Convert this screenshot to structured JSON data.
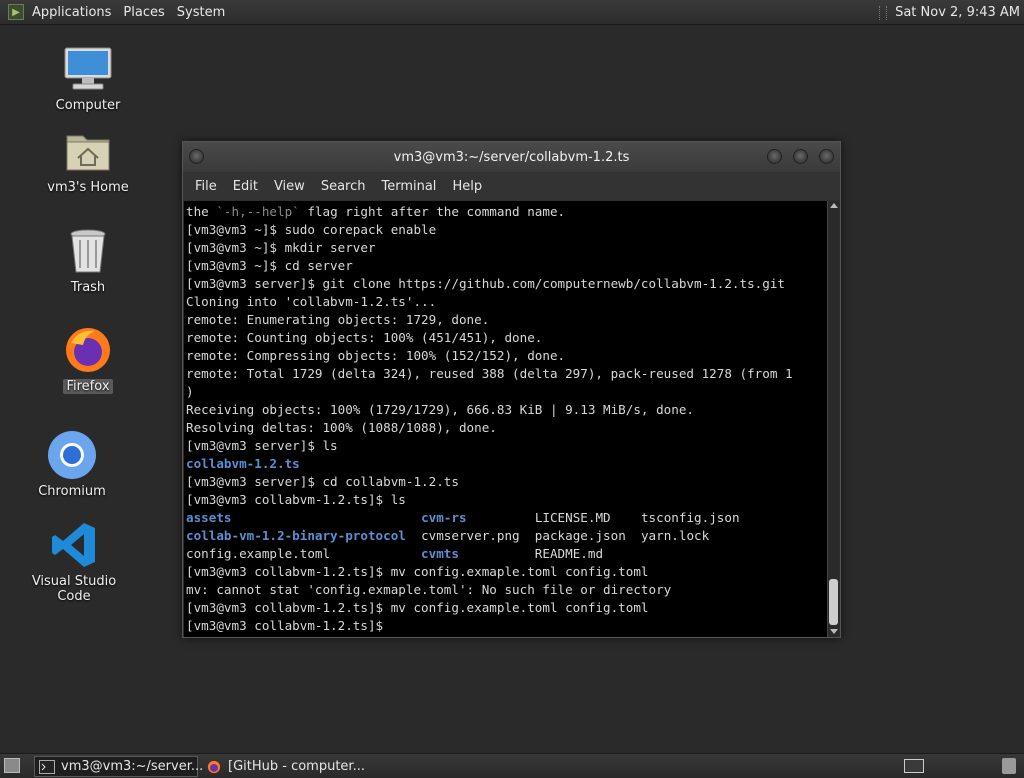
{
  "top_panel": {
    "menus": [
      "Applications",
      "Places",
      "System"
    ],
    "clock": "Sat Nov 2,  9:43 AM"
  },
  "desktop": {
    "icons": [
      {
        "label": "Computer"
      },
      {
        "label": "vm3's Home"
      },
      {
        "label": "Trash"
      },
      {
        "label": "Firefox"
      },
      {
        "label": "Chromium"
      },
      {
        "label": "Visual Studio Code"
      }
    ]
  },
  "terminal": {
    "title": "vm3@vm3:~/server/collabvm-1.2.ts",
    "menu": [
      "File",
      "Edit",
      "View",
      "Search",
      "Terminal",
      "Help"
    ],
    "lines": [
      "the `-h,--help` flag right after the command name.",
      "[vm3@vm3 ~]$ sudo corepack enable",
      "[vm3@vm3 ~]$ mkdir server",
      "[vm3@vm3 ~]$ cd server",
      "[vm3@vm3 server]$ git clone https://github.com/computernewb/collabvm-1.2.ts.git",
      "Cloning into 'collabvm-1.2.ts'...",
      "remote: Enumerating objects: 1729, done.",
      "remote: Counting objects: 100% (451/451), done.",
      "remote: Compressing objects: 100% (152/152), done.",
      "remote: Total 1729 (delta 324), reused 388 (delta 297), pack-reused 1278 (from 1",
      ")",
      "Receiving objects: 100% (1729/1729), 666.83 KiB | 9.13 MiB/s, done.",
      "Resolving deltas: 100% (1088/1088), done.",
      "[vm3@vm3 server]$ ls",
      "collabvm-1.2.ts",
      "[vm3@vm3 server]$ cd collabvm-1.2.ts",
      "[vm3@vm3 collabvm-1.2.ts]$ ls",
      "ls_row_1",
      "ls_row_2",
      "ls_row_3",
      "[vm3@vm3 collabvm-1.2.ts]$ mv config.exmaple.toml config.toml",
      "mv: cannot stat 'config.exmaple.toml': No such file or directory",
      "[vm3@vm3 collabvm-1.2.ts]$ mv config.example.toml config.toml",
      "[vm3@vm3 collabvm-1.2.ts]$ "
    ],
    "ls_output": [
      [
        "assets",
        "cvm-rs",
        "LICENSE.MD",
        "tsconfig.json"
      ],
      [
        "collab-vm-1.2-binary-protocol",
        "cvmserver.png",
        "package.json",
        "yarn.lock"
      ],
      [
        "config.example.toml",
        "cvmts",
        "README.md",
        ""
      ]
    ],
    "dir_color": "#5b8fd1"
  },
  "taskbar": {
    "tasks": [
      {
        "label": "vm3@vm3:~/server..."
      },
      {
        "label": "[GitHub - computer..."
      }
    ]
  }
}
